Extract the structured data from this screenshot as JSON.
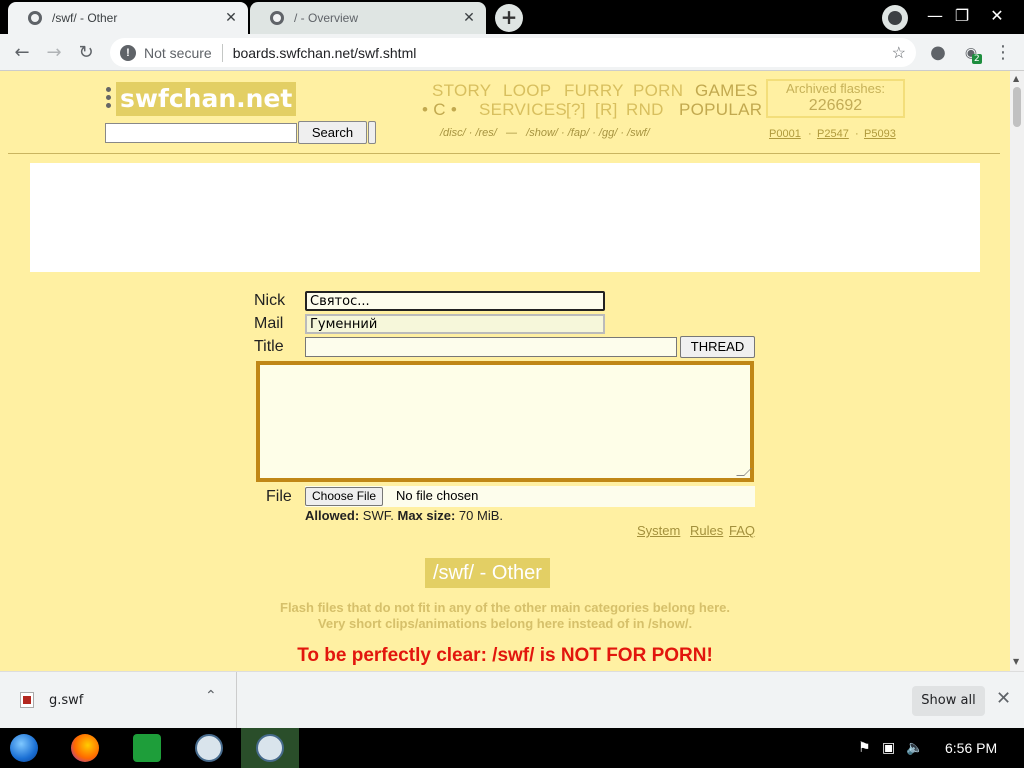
{
  "browser": {
    "tabs": [
      {
        "title": "/swf/ - Other",
        "active": true
      },
      {
        "title": "/ - Overview",
        "active": false
      }
    ],
    "new_tab_label": "+",
    "url_security": "Not secure",
    "url": "boards.swfchan.net/swf.shtml",
    "extension_badge": "2"
  },
  "site": {
    "logo": "swfchan.net",
    "search_button": "Search",
    "nav_row1": [
      "STORY",
      "LOOP",
      "FURRY",
      "PORN",
      "GAMES"
    ],
    "nav_row2": [
      "• C •",
      "SERVICES",
      "[?]",
      "[R]",
      "RND",
      "POPULAR"
    ],
    "nav_small": "/disc/ · /res/   —   /show/ · /fap/ · /gg/ · /swf/",
    "archived_label": "Archived flashes:",
    "archived_count": "226692",
    "plinks": [
      "P0001",
      "P2547",
      "P5093"
    ],
    "plink_sep": "·"
  },
  "form": {
    "nick_label": "Nick",
    "nick_value": "Святос...",
    "mail_label": "Mail",
    "mail_value": "Гуменний",
    "title_label": "Title",
    "title_value": "",
    "thread_button": "THREAD",
    "file_label": "File",
    "choose_file_button": "Choose File",
    "no_file_text": "No file chosen",
    "allowed_label": "Allowed:",
    "allowed_value": "SWF.",
    "maxsize_label": "Max size:",
    "maxsize_value": "70 MiB.",
    "links": [
      "System",
      "Rules",
      "FAQ"
    ]
  },
  "board": {
    "title": "/swf/ - Other",
    "desc1": "Flash files that do not fit in any of the other main categories belong here.",
    "desc2": "Very short clips/animations belong here instead of in /show/.",
    "warning": "To be perfectly clear: /swf/ is NOT FOR PORN!"
  },
  "downloads": {
    "file_name": "g.swf",
    "show_all": "Show all"
  },
  "taskbar": {
    "clock": "6:56 PM"
  },
  "colors": {
    "page_bg": "#fff0a2",
    "logo_bg": "#e3cf64",
    "warning": "#e2160d",
    "textarea_border": "#c08716"
  }
}
